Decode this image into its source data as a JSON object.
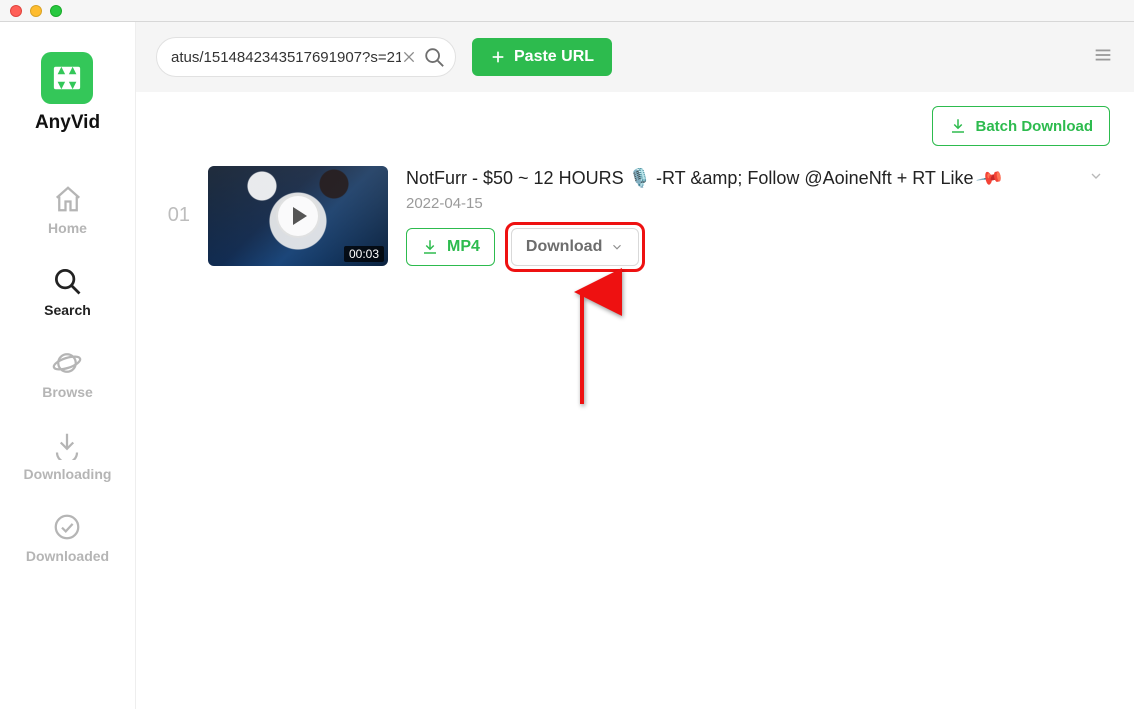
{
  "app": {
    "name": "AnyVid"
  },
  "sidebar": {
    "items": [
      {
        "label": "Home"
      },
      {
        "label": "Search"
      },
      {
        "label": "Browse"
      },
      {
        "label": "Downloading"
      },
      {
        "label": "Downloaded"
      }
    ],
    "active_index": 1
  },
  "topbar": {
    "search_value": "atus/1514842343517691907?s=21",
    "paste_label": "Paste URL"
  },
  "subbar": {
    "batch_label": "Batch Download"
  },
  "results": [
    {
      "index": "01",
      "title_prefix": "NotFurr - $50 ~ 12 HOURS ",
      "title_mid": "🎙️",
      "title_rest": " -RT &amp; Follow @AoineNft + RT Like ",
      "title_end_icon": "📌",
      "date": "2022-04-15",
      "duration": "00:03",
      "mp4_label": "MP4",
      "download_label": "Download"
    }
  ],
  "colors": {
    "accent": "#2dbb4e",
    "callout": "#ee1111",
    "muted": "#b5b5b5"
  }
}
